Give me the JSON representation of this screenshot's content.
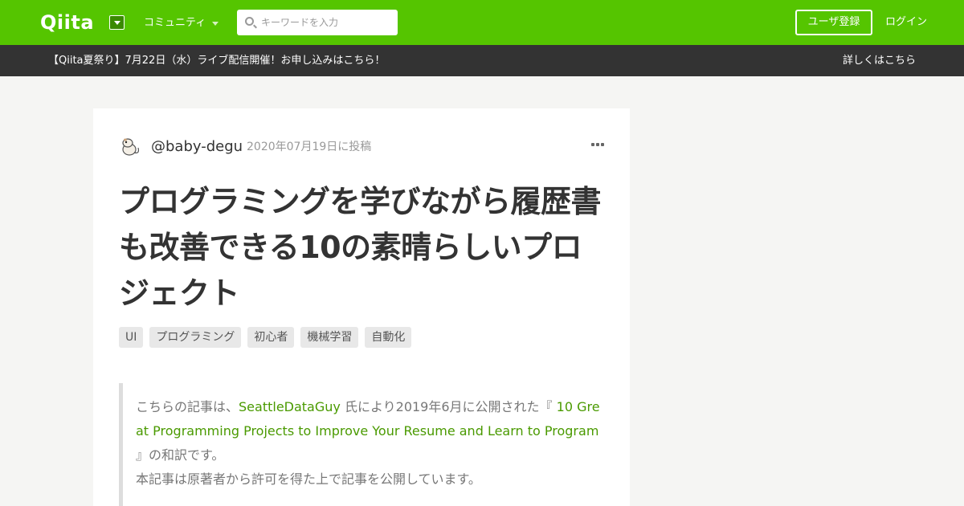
{
  "header": {
    "logo": "Qiita",
    "community_label": "コミュニティ",
    "search_placeholder": "キーワードを入力",
    "signup_label": "ユーザ登録",
    "login_label": "ログイン",
    "brand_color": "#55c500"
  },
  "banner": {
    "text": "【Qiita夏祭り】7月22日（水）ライブ配信開催！お申し込みはこちら！",
    "link_label": "詳しくはこちら"
  },
  "article": {
    "author": "@baby-degu",
    "posted": "2020年07月19日に投稿",
    "title": "プログラミングを学びながら履歴書も改善できる10の素晴らしいプロジェクト",
    "tags": [
      "UI",
      "プログラミング",
      "初心者",
      "機械学習",
      "自動化"
    ],
    "quote": {
      "p1_before": "こちらの記事は、",
      "author_link": "SeattleDataGuy",
      "p1_mid": " 氏により2019年6月に公開された『 ",
      "article_link": "10 Great Programming Projects to Improve Your Resume and Learn to Program",
      "p1_after": " 』の和訳です。",
      "p2": "本記事は原著者から許可を得た上で記事を公開しています。"
    }
  }
}
